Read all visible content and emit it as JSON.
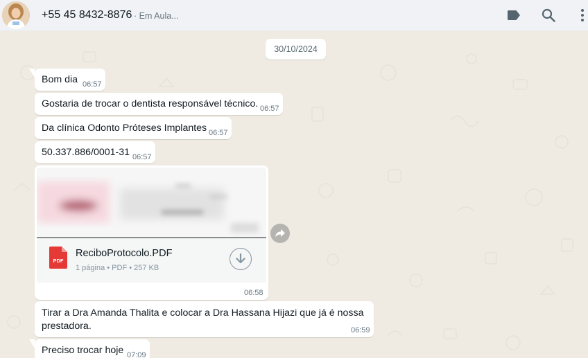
{
  "header": {
    "contact_name": "+55 45 8432-8876",
    "status": "· Em Aula..."
  },
  "chat": {
    "date_separator": "30/10/2024",
    "messages": [
      {
        "text": "Bom dia",
        "time": "06:57"
      },
      {
        "text": "Gostaria de trocar o dentista responsável técnico.",
        "time": "06:57"
      },
      {
        "text": "Da clínica Odonto Próteses Implantes",
        "time": "06:57"
      },
      {
        "text": "50.337.886/0001-31",
        "time": "06:57"
      },
      {
        "document": {
          "file_name": "ReciboProtocolo.PDF",
          "meta": "1 página • PDF • 257 KB",
          "type_label": "PDF"
        },
        "time": "06:58"
      },
      {
        "text_line1": "Tirar a Dra Amanda Thalita e colocar a Dra Hassana Hijazi que já é nossa",
        "text_line2": "prestadora.",
        "time": "06:59"
      },
      {
        "text": "Preciso trocar hoje",
        "time": "07:09"
      }
    ]
  },
  "icons": {
    "label": "label-icon",
    "search": "search-icon",
    "menu": "menu-dots-icon",
    "download": "download-icon",
    "forward": "forward-icon"
  },
  "colors": {
    "chat_background": "#efeae2",
    "bubble": "#ffffff",
    "header": "#f0f2f5",
    "pdf_red": "#e53935",
    "timestamp": "#667781"
  }
}
